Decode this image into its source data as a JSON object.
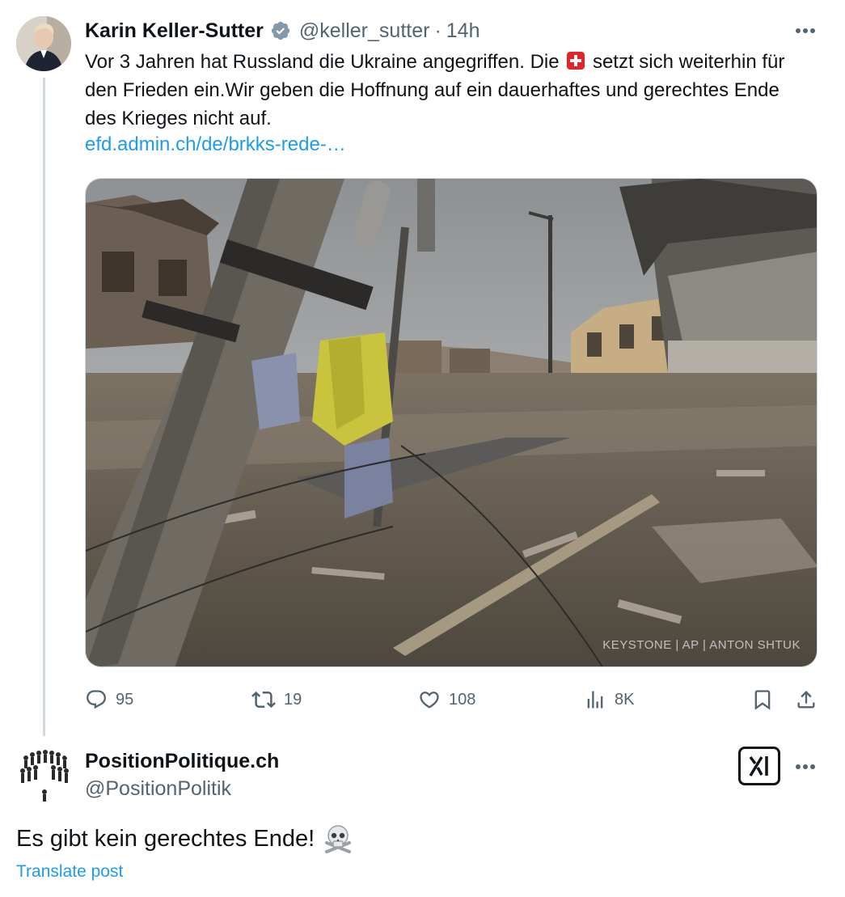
{
  "tweet": {
    "author_name": "Karin Keller-Sutter",
    "author_handle": "@keller_sutter",
    "separator": "·",
    "time": "14h",
    "text_before_flag": "Vor 3 Jahren hat Russland die Ukraine angegriffen. Die",
    "flag_icon": "swiss-flag-icon",
    "text_after_flag": "setzt sich weiterhin für den Frieden ein.Wir geben die Hoffnung auf ein dauerhaftes und gerechtes Ende des Krieges nicht auf.",
    "link": "efd.admin.ch/de/brkks-rede-…",
    "image_credit": "KEYSTONE | AP | ANTON SHTUK",
    "stats": {
      "replies": "95",
      "reposts": "19",
      "likes": "108",
      "views": "8K"
    }
  },
  "reply": {
    "author_name": "PositionPolitique.ch",
    "author_handle": "@PositionPolitik",
    "text": "Es gibt kein gerechtes Ende!",
    "emoji_icon": "skull-crossbones-icon",
    "translate_label": "Translate post"
  },
  "colors": {
    "accent": "#1d9bf0",
    "secondary_text": "#536471",
    "primary_text": "#0f1419",
    "thread_line": "#cfd9de"
  }
}
